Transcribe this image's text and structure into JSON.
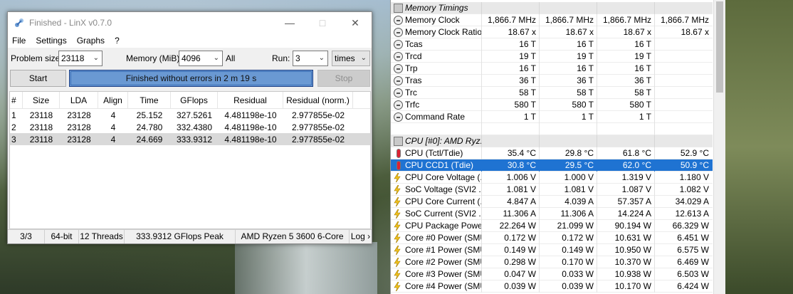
{
  "linx": {
    "title": "Finished - LinX v0.7.0",
    "menu": [
      "File",
      "Settings",
      "Graphs",
      "?"
    ],
    "problem_size_label": "Problem size:",
    "problem_size_value": "23118",
    "memory_label": "Memory (MiB):",
    "memory_value": "4096",
    "memory_all": "All",
    "run_label": "Run:",
    "run_value": "3",
    "run_unit": "times",
    "start_label": "Start",
    "progress_text": "Finished without errors in 2 m 19 s",
    "progress_fraction": 1.0,
    "stop_label": "Stop",
    "table": {
      "headers": [
        "#",
        "Size",
        "LDA",
        "Align",
        "Time",
        "GFlops",
        "Residual",
        "Residual (norm.)"
      ],
      "rows": [
        [
          "1",
          "23118",
          "23128",
          "4",
          "25.152",
          "327.5261",
          "4.481198e-10",
          "2.977855e-02"
        ],
        [
          "2",
          "23118",
          "23128",
          "4",
          "24.780",
          "332.4380",
          "4.481198e-10",
          "2.977855e-02"
        ],
        [
          "3",
          "23118",
          "23128",
          "4",
          "24.669",
          "333.9312",
          "4.481198e-10",
          "2.977855e-02"
        ]
      ]
    },
    "status": [
      "3/3",
      "64-bit",
      "12 Threads",
      "333.9312 GFlops Peak",
      "AMD Ryzen 5 3600 6-Core",
      "Log"
    ]
  },
  "hwinfo": {
    "rows": [
      {
        "type": "section",
        "name": "Memory Timings",
        "vals": [
          "",
          "",
          "",
          ""
        ],
        "icon": "chip-icon"
      },
      {
        "type": "row",
        "name": "Memory Clock",
        "vals": [
          "1,866.7 MHz",
          "1,866.7 MHz",
          "1,866.7 MHz",
          "1,866.7 MHz"
        ],
        "icon": "clock-icon"
      },
      {
        "type": "row",
        "name": "Memory Clock Ratio",
        "vals": [
          "18.67 x",
          "18.67 x",
          "18.67 x",
          "18.67 x"
        ],
        "icon": "clock-icon"
      },
      {
        "type": "row",
        "name": "Tcas",
        "vals": [
          "16 T",
          "16 T",
          "16 T",
          ""
        ],
        "icon": "clock-icon"
      },
      {
        "type": "row",
        "name": "Trcd",
        "vals": [
          "19 T",
          "19 T",
          "19 T",
          ""
        ],
        "icon": "clock-icon"
      },
      {
        "type": "row",
        "name": "Trp",
        "vals": [
          "16 T",
          "16 T",
          "16 T",
          ""
        ],
        "icon": "clock-icon"
      },
      {
        "type": "row",
        "name": "Tras",
        "vals": [
          "36 T",
          "36 T",
          "36 T",
          ""
        ],
        "icon": "clock-icon"
      },
      {
        "type": "row",
        "name": "Trc",
        "vals": [
          "58 T",
          "58 T",
          "58 T",
          ""
        ],
        "icon": "clock-icon"
      },
      {
        "type": "row",
        "name": "Trfc",
        "vals": [
          "580 T",
          "580 T",
          "580 T",
          ""
        ],
        "icon": "clock-icon"
      },
      {
        "type": "row",
        "name": "Command Rate",
        "vals": [
          "1 T",
          "1 T",
          "1 T",
          ""
        ],
        "icon": "clock-icon"
      },
      {
        "type": "blank",
        "name": "",
        "vals": [
          "",
          "",
          "",
          ""
        ],
        "icon": ""
      },
      {
        "type": "section",
        "name": "CPU [#0]: AMD Ryz...",
        "vals": [
          "",
          "",
          "",
          ""
        ],
        "icon": "chip-icon"
      },
      {
        "type": "row",
        "name": "CPU (Tctl/Tdie)",
        "vals": [
          "35.4 °C",
          "29.8 °C",
          "61.8 °C",
          "52.9 °C"
        ],
        "icon": "thermometer-icon"
      },
      {
        "type": "selected",
        "name": "CPU CCD1 (Tdie)",
        "vals": [
          "30.8 °C",
          "29.5 °C",
          "62.0 °C",
          "50.9 °C"
        ],
        "icon": "thermometer-icon"
      },
      {
        "type": "row",
        "name": "CPU Core Voltage (...",
        "vals": [
          "1.006 V",
          "1.000 V",
          "1.319 V",
          "1.180 V"
        ],
        "icon": "bolt-icon"
      },
      {
        "type": "row",
        "name": "SoC Voltage (SVI2 ...",
        "vals": [
          "1.081 V",
          "1.081 V",
          "1.087 V",
          "1.082 V"
        ],
        "icon": "bolt-icon"
      },
      {
        "type": "row",
        "name": "CPU Core Current (...",
        "vals": [
          "4.847 A",
          "4.039 A",
          "57.357 A",
          "34.029 A"
        ],
        "icon": "bolt-icon"
      },
      {
        "type": "row",
        "name": "SoC Current (SVI2 ...",
        "vals": [
          "11.306 A",
          "11.306 A",
          "14.224 A",
          "12.613 A"
        ],
        "icon": "bolt-icon"
      },
      {
        "type": "row",
        "name": "CPU Package Powe...",
        "vals": [
          "22.264 W",
          "21.099 W",
          "90.194 W",
          "66.329 W"
        ],
        "icon": "bolt-icon"
      },
      {
        "type": "row",
        "name": "Core #0 Power (SMU)",
        "vals": [
          "0.172 W",
          "0.172 W",
          "10.631 W",
          "6.451 W"
        ],
        "icon": "bolt-icon"
      },
      {
        "type": "row",
        "name": "Core #1 Power (SMU)",
        "vals": [
          "0.149 W",
          "0.149 W",
          "10.950 W",
          "6.575 W"
        ],
        "icon": "bolt-icon"
      },
      {
        "type": "row",
        "name": "Core #2 Power (SMU)",
        "vals": [
          "0.298 W",
          "0.170 W",
          "10.370 W",
          "6.469 W"
        ],
        "icon": "bolt-icon"
      },
      {
        "type": "row",
        "name": "Core #3 Power (SMU)",
        "vals": [
          "0.047 W",
          "0.033 W",
          "10.938 W",
          "6.503 W"
        ],
        "icon": "bolt-icon"
      },
      {
        "type": "row",
        "name": "Core #4 Power (SMU)",
        "vals": [
          "0.039 W",
          "0.039 W",
          "10.170 W",
          "6.424 W"
        ],
        "icon": "bolt-icon"
      }
    ]
  }
}
